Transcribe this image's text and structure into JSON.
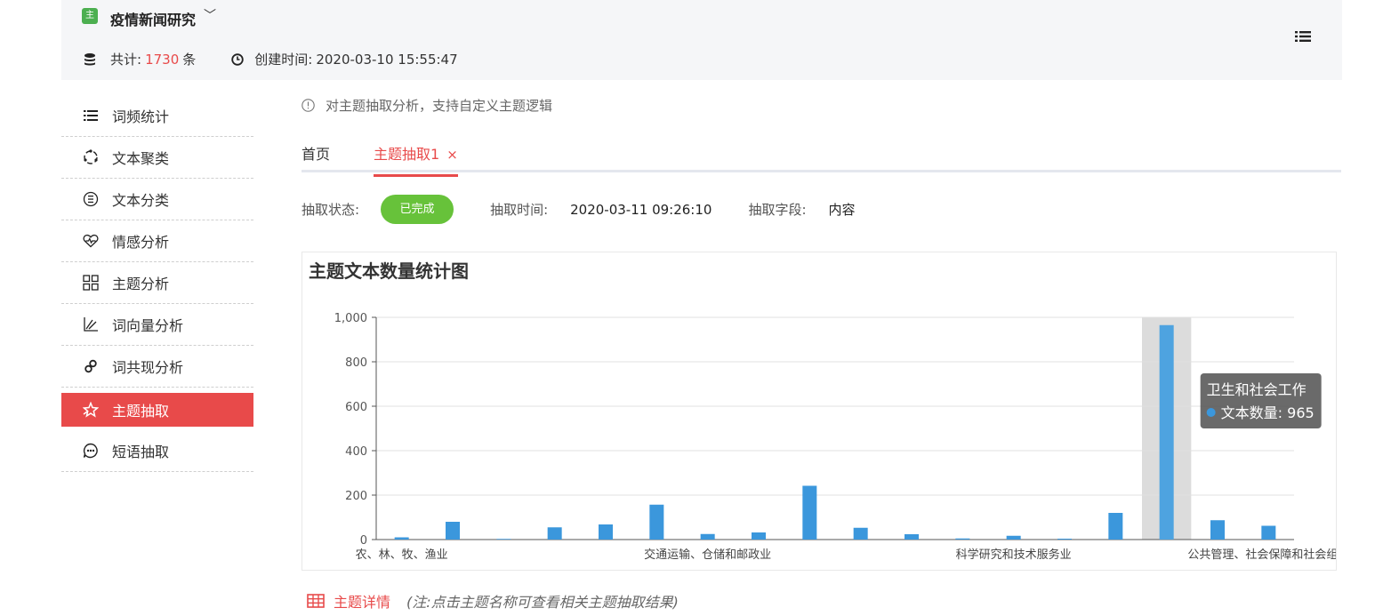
{
  "header": {
    "badge": "主",
    "project_name": "疫情新闻研究",
    "caret": "﹀",
    "total_label": "共计:",
    "total_count": "1730",
    "total_unit": "条",
    "created_label": "创建时间:",
    "created_time": "2020-03-10 15:55:47"
  },
  "sidebar": {
    "items": [
      {
        "label": "词频统计",
        "icon": "list-icon"
      },
      {
        "label": "文本聚类",
        "icon": "cluster-icon"
      },
      {
        "label": "文本分类",
        "icon": "classify-icon"
      },
      {
        "label": "情感分析",
        "icon": "heart-icon"
      },
      {
        "label": "主题分析",
        "icon": "grid-icon"
      },
      {
        "label": "词向量分析",
        "icon": "vector-icon"
      },
      {
        "label": "词共现分析",
        "icon": "link-icon"
      },
      {
        "label": "主题抽取",
        "icon": "star-icon",
        "active": true
      },
      {
        "label": "短语抽取",
        "icon": "chat-icon"
      }
    ]
  },
  "tip": "对主题抽取分析，支持自定义主题逻辑",
  "tabs": {
    "home": "首页",
    "current": "主题抽取1",
    "close": "×"
  },
  "status": {
    "state_label": "抽取状态:",
    "state_value": "已完成",
    "time_label": "抽取时间:",
    "time_value": "2020-03-11 09:26:10",
    "field_label": "抽取字段:",
    "field_value": "内容"
  },
  "colors": {
    "accent": "#e84a4a",
    "bar": "#3b97dc",
    "success": "#67c23a"
  },
  "chart_data": {
    "type": "bar",
    "title": "主题文本数量统计图",
    "categories": [
      "农、林、牧、渔业",
      "",
      "",
      "",
      "",
      "",
      "交通运输、仓储和邮政业",
      "",
      "",
      "",
      "",
      "",
      "科学研究和技术服务业",
      "",
      "",
      "",
      "",
      "卫生和社会工作",
      "",
      "公共管理、社会保障和社会组织"
    ],
    "values": [
      10,
      80,
      3,
      55,
      68,
      157,
      25,
      32,
      242,
      53,
      24,
      5,
      17,
      4,
      120,
      965,
      87,
      62
    ],
    "ylim": [
      0,
      1000
    ],
    "yticks": [
      "0",
      "200",
      "400",
      "600",
      "800",
      "1,000"
    ],
    "xtick_labels": [
      {
        "index": 0,
        "label": "农、林、牧、渔业"
      },
      {
        "index": 6,
        "label": "交通运输、仓储和邮政业"
      },
      {
        "index": 12,
        "label": "科学研究和技术服务业"
      },
      {
        "index": 17,
        "label": "公共管理、社会保障和社会组织"
      }
    ],
    "highlight_index": 15,
    "tooltip": {
      "title": "卫生和社会工作",
      "series_label": "文本数量:",
      "value": "965"
    }
  },
  "details": {
    "label": "主题详情",
    "note": "(注:点击主题名称可查看相关主题抽取结果)"
  }
}
